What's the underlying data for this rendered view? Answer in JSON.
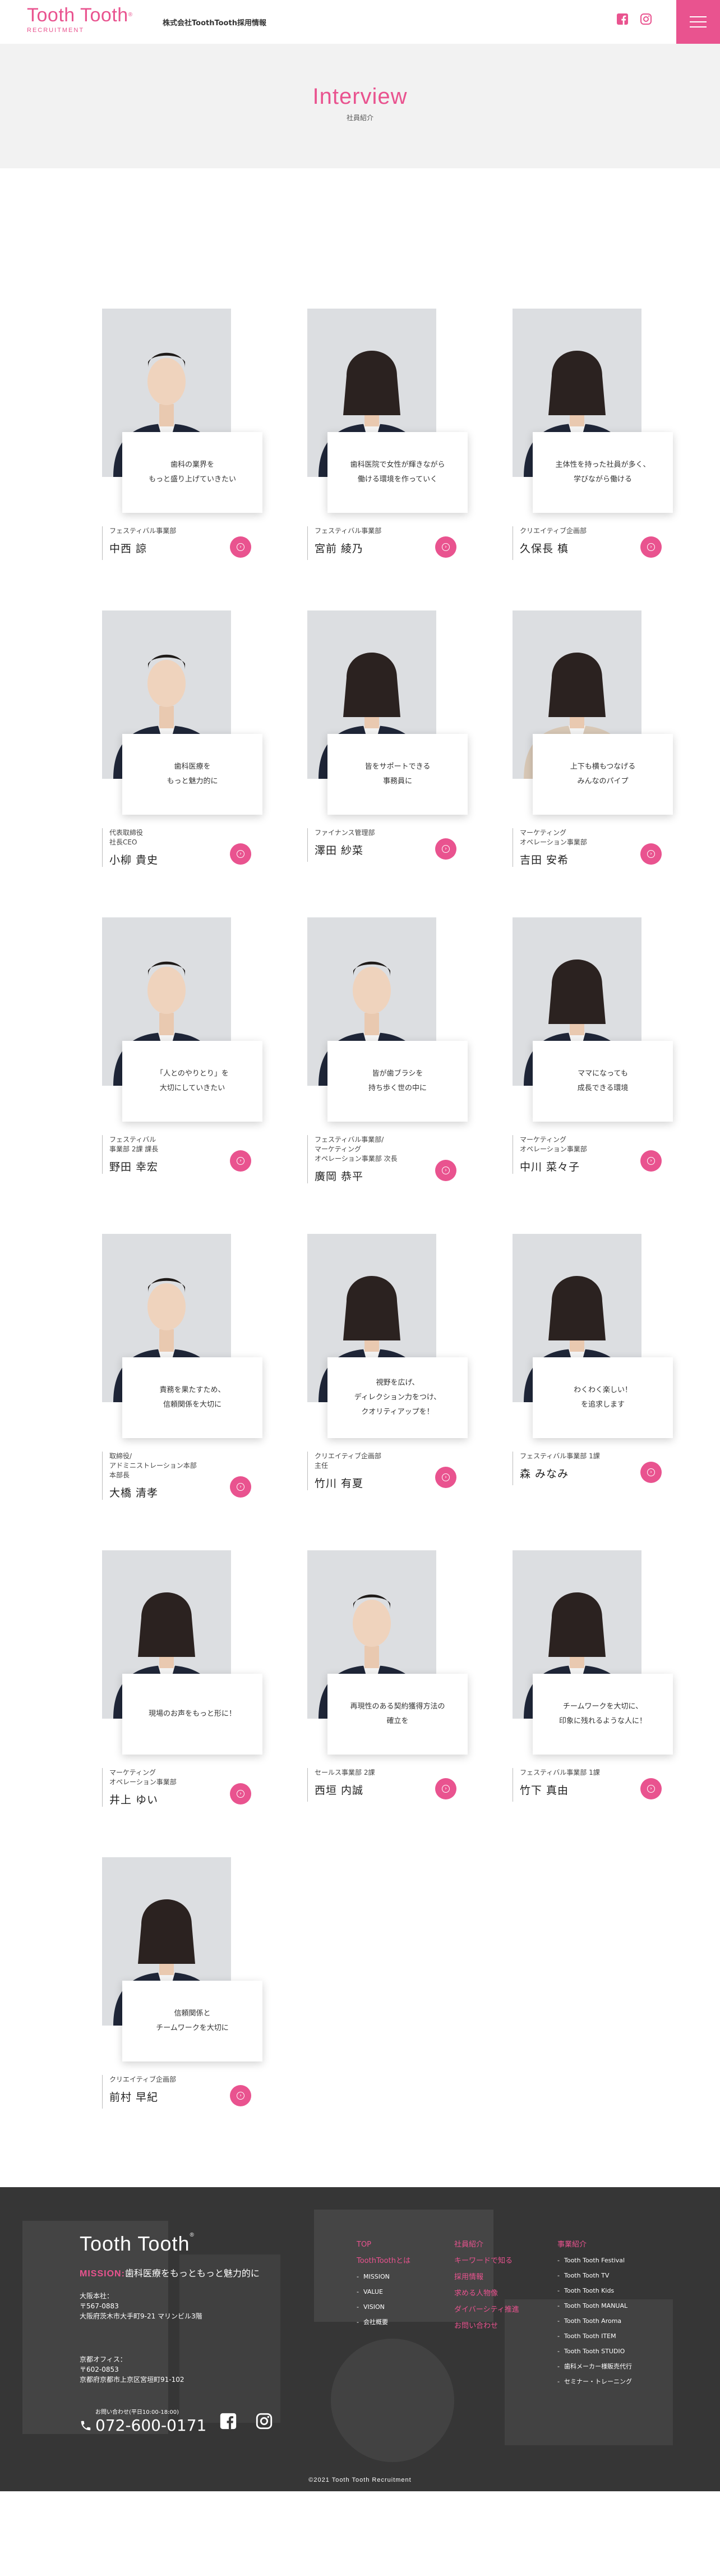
{
  "header": {
    "logo_main": "Tooth Tooth",
    "logo_reg": "®",
    "logo_sub": "RECRUITMENT",
    "company": "株式会社ToothTooth採用情報",
    "icons": [
      "facebook-icon",
      "instagram-icon"
    ],
    "accent": "#e9538f"
  },
  "title": {
    "en": "Interview",
    "ja": "社員紹介"
  },
  "members": [
    {
      "quote": "歯科の業界を\nもっと盛り上げていきたい",
      "dept": "フェスティバル事業部",
      "name": "中西 諒"
    },
    {
      "quote": "歯科医院で女性が輝きながら\n働ける環境を作っていく",
      "dept": "フェスティバル事業部",
      "name": "宮前 綾乃"
    },
    {
      "quote": "主体性を持った社員が多く、\n学びながら働ける",
      "dept": "クリエイティブ企画部",
      "name": "久保長 槙"
    },
    {
      "quote": "歯科医療を\nもっと魅力的に",
      "dept": "代表取締役\n社長CEO",
      "name": "小柳 貴史"
    },
    {
      "quote": "皆をサポートできる\n事務員に",
      "dept": "ファイナンス管理部",
      "name": "澤田 紗菜"
    },
    {
      "quote": "上下も横もつなげる\nみんなのパイプ",
      "dept": "マーケティング\nオペレーション事業部",
      "name": "吉田 安希"
    },
    {
      "quote": "「人とのやりとり」を\n大切にしていきたい",
      "dept": "フェスティバル\n事業部 2課 課長",
      "name": "野田 幸宏"
    },
    {
      "quote": "皆が歯ブラシを\n持ち歩く世の中に",
      "dept": "フェスティバル事業部/\nマーケティング\nオペレーション事業部 次長",
      "name": "廣岡 恭平"
    },
    {
      "quote": "ママになっても\n成長できる環境",
      "dept": "マーケティング\nオペレーション事業部",
      "name": "中川 菜々子"
    },
    {
      "quote": "責務を果たすため、\n信頼関係を大切に",
      "dept": "取締役/\nアドミニストレーション本部\n本部長",
      "name": "大橋 清孝"
    },
    {
      "quote": "視野を広げ、\nディレクション力をつけ、\nクオリティアップを！",
      "dept": "クリエイティブ企画部\n主任",
      "name": "竹川 有夏"
    },
    {
      "quote": "わくわく楽しい！\nを追求します",
      "dept": "フェスティバル事業部 1課",
      "name": "森 みなみ"
    },
    {
      "quote": "現場のお声をもっと形に！",
      "dept": "マーケティング\nオペレーション事業部",
      "name": "井上 ゆい"
    },
    {
      "quote": "再現性のある契約獲得方法の\n確立を",
      "dept": "セールス事業部 2課",
      "name": "西垣 内誠"
    },
    {
      "quote": "チームワークを大切に、\n印象に残れるような人に！",
      "dept": "フェスティバル事業部 1課",
      "name": "竹下 真由"
    },
    {
      "quote": "信頼関係と\nチームワークを大切に",
      "dept": "クリエイティブ企画部",
      "name": "前村 早紀"
    }
  ],
  "footer": {
    "logo": "Tooth Tooth",
    "logo_reg": "®",
    "mission_label": "MISSION:",
    "mission_text": "歯科医療をもっともっと魅力的に",
    "osaka": "大阪本社：\n〒567-0883\n大阪府茨木市大手町9-21 マリンビル3階",
    "kyoto": "京都オフィス：\n〒602-0853\n京都府京都市上京区宮垣町91-102",
    "hours": "お問い合わせ(平日10:00-18:00)",
    "tel": "072-600-0171",
    "col1": [
      "TOP",
      "ToothToothとは",
      "MISSION",
      "VALUE",
      "VISION",
      "会社概要"
    ],
    "col2": [
      "社員紹介",
      "キーワードで知る",
      "採用情報",
      "求める人物像",
      "ダイバーシティ推進",
      "お問い合わせ"
    ],
    "col3_title": "事業紹介",
    "col3": [
      "Tooth Tooth Festival",
      "Tooth Tooth TV",
      "Tooth Tooth Kids",
      "Tooth Tooth MANUAL",
      "Tooth Tooth Aroma",
      "Tooth Tooth ITEM",
      "Tooth Tooth STUDIO",
      "歯科メーカー様販売代行",
      "セミナー・トレーニング"
    ],
    "copyright": "©2021 Tooth Tooth Recruitment"
  }
}
